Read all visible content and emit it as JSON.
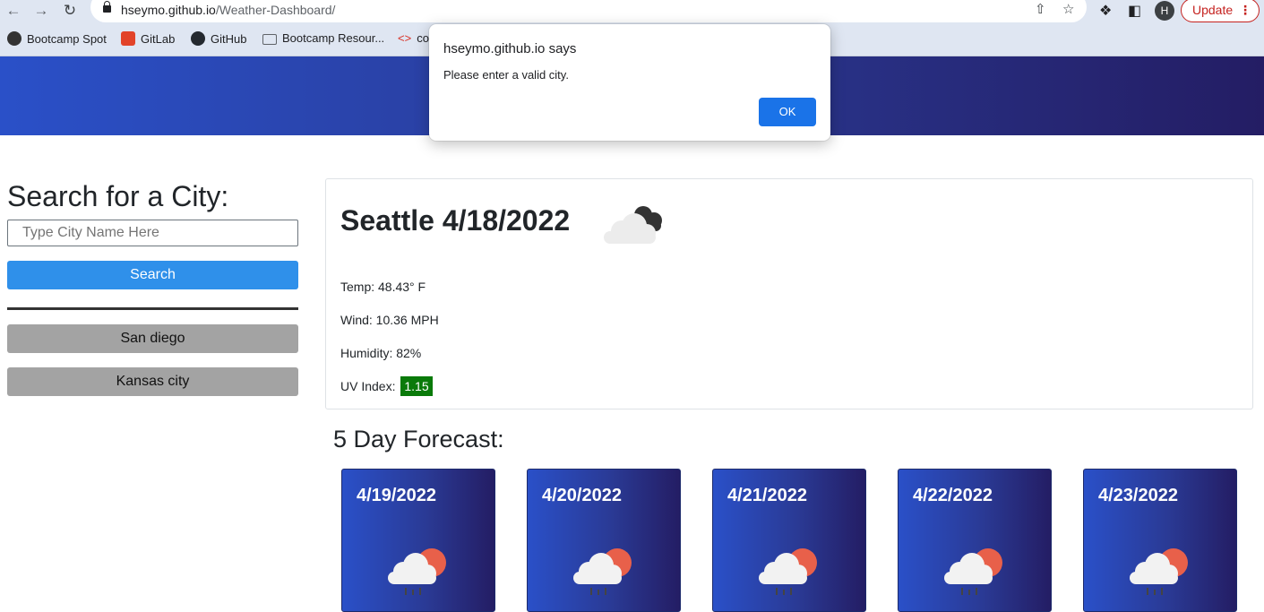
{
  "browser": {
    "url_host": "hseymo.github.io",
    "url_path": "/Weather-Dashboard/",
    "avatar_letter": "H",
    "update_label": "Update",
    "bookmarks": [
      {
        "label": "Bootcamp Spot"
      },
      {
        "label": "GitLab"
      },
      {
        "label": "GitHub"
      },
      {
        "label": "Bootcamp Resour..."
      },
      {
        "label": "co"
      }
    ]
  },
  "dialog": {
    "title": "hseymo.github.io says",
    "message": "Please enter a valid city.",
    "ok_label": "OK"
  },
  "sidebar": {
    "title": "Search for a City:",
    "input_placeholder": "Type City Name Here",
    "search_label": "Search",
    "history": [
      "San diego",
      "Kansas city"
    ]
  },
  "current": {
    "heading": "Seattle 4/18/2022",
    "icon": "cloudy-icon",
    "temp": "Temp: 48.43° F",
    "wind": "Wind: 10.36 MPH",
    "humidity": "Humidity: 82%",
    "uv_label": "UV Index:",
    "uv_value": "1.15",
    "uv_color": "#0a7a0a"
  },
  "forecast": {
    "title": "5 Day Forecast:",
    "days": [
      {
        "date": "4/19/2022",
        "icon": "rain-sun-icon"
      },
      {
        "date": "4/20/2022",
        "icon": "rain-sun-icon"
      },
      {
        "date": "4/21/2022",
        "icon": "rain-sun-icon"
      },
      {
        "date": "4/22/2022",
        "icon": "rain-sun-icon"
      },
      {
        "date": "4/23/2022",
        "icon": "rain-sun-icon"
      }
    ]
  },
  "colors": {
    "accent": "#2f90ea",
    "hero_start": "#2a50c8",
    "hero_end": "#241d64",
    "history_bg": "#a3a3a3",
    "dialog_button": "#1a73e8"
  }
}
